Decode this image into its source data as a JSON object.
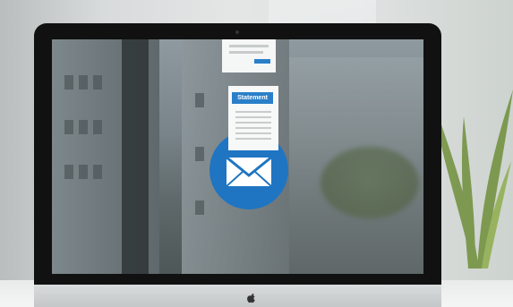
{
  "statement_card": {
    "tag_label": "Statement"
  },
  "colors": {
    "accent_blue": "#1f75c2",
    "card": "#f7f8f8"
  },
  "icons": [
    "envelope-icon",
    "apple-logo-icon",
    "document-icon"
  ]
}
